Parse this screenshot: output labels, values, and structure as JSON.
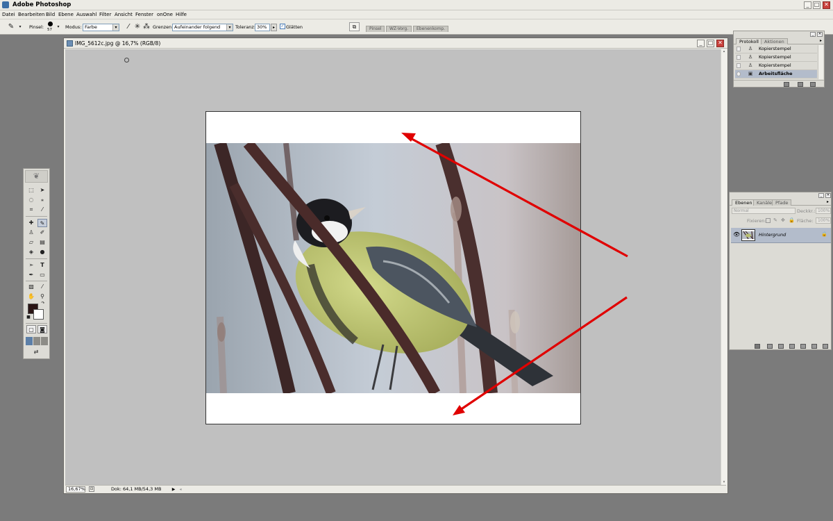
{
  "window": {
    "title": "Adobe Photoshop",
    "controls": {
      "minimize": "_",
      "maximize": "□",
      "close": "✕"
    }
  },
  "menu": [
    "Datei",
    "Bearbeiten",
    "Bild",
    "Ebene",
    "Auswahl",
    "Filter",
    "Ansicht",
    "Fenster",
    "onOne",
    "Hilfe"
  ],
  "options": {
    "brush_label": "Pinsel:",
    "brush_size": "57",
    "mode_label": "Modus:",
    "mode_value": "Farbe",
    "limits_label": "Grenzen:",
    "limits_value": "Aufeinander folgend",
    "tolerance_label": "Toleranz:",
    "tolerance_value": "30%",
    "antialias_label": "Glätten",
    "antialias_checked": true,
    "palette_well_tabs": [
      "Pinsel",
      "WZ-Vorg.",
      "Ebenenkomp."
    ]
  },
  "document": {
    "title": "IMG_5612c.jpg @ 16,7% (RGB/8)",
    "zoom": "16,67%",
    "doc_info": "Dok: 64,1 MB/54,3 MB"
  },
  "history": {
    "tabs": [
      "Protokoll",
      "Aktionen"
    ],
    "active_tab": "Protokoll",
    "steps": [
      {
        "label": "Kopierstempel",
        "selected": false
      },
      {
        "label": "Kopierstempel",
        "selected": false
      },
      {
        "label": "Kopierstempel",
        "selected": false
      },
      {
        "label": "Arbeitsfläche",
        "selected": true
      }
    ]
  },
  "layers": {
    "tabs": [
      "Ebenen",
      "Kanäle",
      "Pfade"
    ],
    "active_tab": "Ebenen",
    "blend_mode": "Normal",
    "opacity_label": "Deckkr.:",
    "opacity_value": "100%",
    "lock_label": "Fixieren:",
    "fill_label": "Fläche:",
    "fill_value": "100%",
    "items": [
      {
        "name": "Hintergrund",
        "visible": true,
        "locked": true
      }
    ]
  },
  "colors": {
    "foreground": "#2a1414",
    "background": "#ffffff",
    "annotation_arrows": "#e00000",
    "canvas_gray": "#c0c0c0",
    "selection_blue": "#b3bccb"
  }
}
